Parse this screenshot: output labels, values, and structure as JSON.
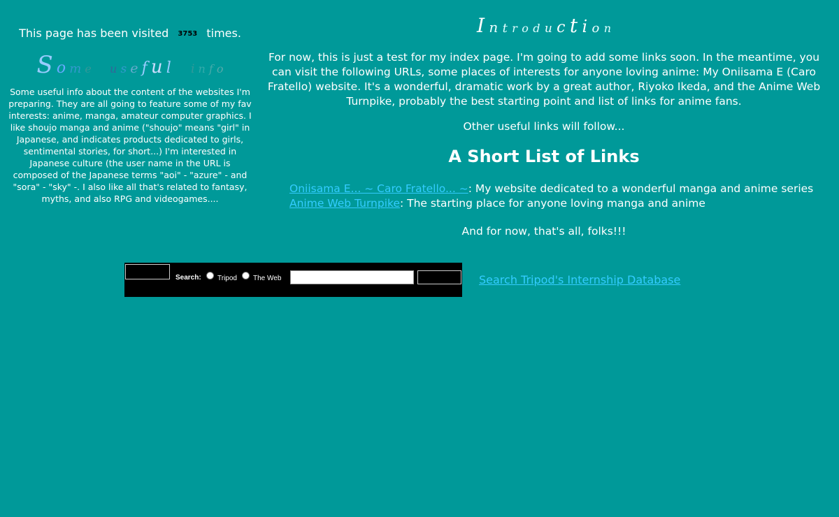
{
  "left": {
    "visit_prefix": "This page has been visited",
    "visit_count": "3753",
    "visit_suffix": "times.",
    "heading_letters": [
      "S",
      "o",
      "m",
      "e",
      " ",
      "u",
      "s",
      "e",
      "f",
      "u",
      "l",
      " ",
      "i",
      "n",
      "f",
      "o"
    ],
    "body": "Some useful info about the content of the websites I'm preparing. They are all going to feature some of my fav interests: anime, manga, amateur computer graphics. I like shoujo manga and anime (\"shoujo\" means \"girl\" in Japanese, and indicates products dedicated to girls, sentimental stories, for short...) I'm interested in Japanese culture (the user name in the URL is composed of the Japanese terms \"aoi\" - \"azure\" - and \"sora\" - \"sky\" -. I also like all that's related to fantasy, myths, and also RPG and videogames...."
  },
  "right": {
    "title_letters": [
      "I",
      "n",
      "t",
      "r",
      "o",
      "d",
      "u",
      "c",
      "t",
      "i",
      "o",
      "n"
    ],
    "intro": "For now, this is just a test for my index page. I'm going to add some links soon. In the meantime, you can visit the following URLs, some places of interests for anyone loving anime: My Oniisama E (Caro Fratello) website. It's a wonderful, dramatic work by a great author, Riyoko Ikeda, and the Anime Web Turnpike, probably the best starting point and list of links for anime fans.",
    "other_links": "Other useful links will follow...",
    "list_heading": "A Short List of Links",
    "links": [
      {
        "text": "Oniisama E... ~ Caro Fratello... ~",
        "desc": ": My website dedicated to a wonderful manga and anime series"
      },
      {
        "text": "Anime Web Turnpike",
        "desc": ": The starting place for anyone loving manga and anime"
      }
    ],
    "thats_all": "And for now, that's all, folks!!!"
  },
  "search": {
    "label": "Search:",
    "option_tripod": "Tripod",
    "option_web": "The Web",
    "input_value": ""
  },
  "internship_link": "Search Tripod's Internship Database",
  "colors": {
    "background": "#009999",
    "link": "#33ccff",
    "text": "#ffffff"
  }
}
